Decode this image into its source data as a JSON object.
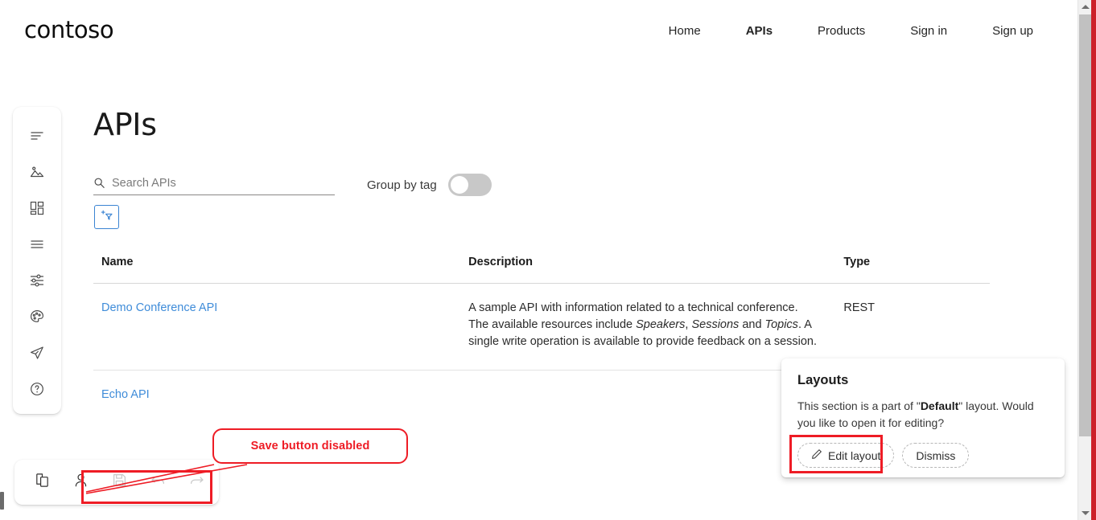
{
  "header": {
    "brand": "contoso",
    "nav": [
      {
        "label": "Home",
        "active": false
      },
      {
        "label": "APIs",
        "active": true
      },
      {
        "label": "Products",
        "active": false
      },
      {
        "label": "Sign in",
        "active": false
      },
      {
        "label": "Sign up",
        "active": false
      }
    ]
  },
  "editor_rail": {
    "items": [
      {
        "name": "content-icon",
        "label": "Content"
      },
      {
        "name": "media-icon",
        "label": "Media"
      },
      {
        "name": "widgets-icon",
        "label": "Widgets"
      },
      {
        "name": "pages-icon",
        "label": "Pages"
      },
      {
        "name": "settings-sliders-icon",
        "label": "Settings"
      },
      {
        "name": "theme-palette-icon",
        "label": "Styles"
      },
      {
        "name": "publish-icon",
        "label": "Publish"
      },
      {
        "name": "help-icon",
        "label": "Help"
      }
    ]
  },
  "main": {
    "title": "APIs",
    "search": {
      "placeholder": "Search APIs",
      "value": ""
    },
    "group_by_tag": {
      "label": "Group by tag",
      "state": "off"
    },
    "filter_button": {
      "name": "add-filter-button",
      "border_color": "#3b84d2"
    },
    "table": {
      "columns": [
        "Name",
        "Description",
        "Type"
      ],
      "rows": [
        {
          "name": "Demo Conference API",
          "description_lines": [
            {
              "segments": [
                {
                  "text": "A sample API with information related to a technical conference.",
                  "em": false
                }
              ]
            },
            {
              "segments": [
                {
                  "text": "The available resources include ",
                  "em": false
                },
                {
                  "text": "Speakers",
                  "em": true
                },
                {
                  "text": ", ",
                  "em": false
                },
                {
                  "text": "Sessions",
                  "em": true
                },
                {
                  "text": " and ",
                  "em": false
                },
                {
                  "text": "Topics",
                  "em": true
                },
                {
                  "text": ". A",
                  "em": false
                }
              ]
            },
            {
              "segments": [
                {
                  "text": "single write operation is available to provide feedback on a session.",
                  "em": false
                }
              ]
            }
          ],
          "type": "REST"
        },
        {
          "name": "Echo API",
          "description_lines": [],
          "type": ""
        }
      ]
    }
  },
  "layouts_popup": {
    "title": "Layouts",
    "body_prefix": "This section is a part of \"",
    "body_bold": "Default",
    "body_suffix": "\" layout. Would you like to open it for editing?",
    "edit_label": "Edit layout",
    "dismiss_label": "Dismiss"
  },
  "bottom_toolbar": {
    "buttons": [
      {
        "name": "duplicate-icon",
        "label": "Duplicate",
        "disabled": false
      },
      {
        "name": "user-icon",
        "label": "Profile",
        "disabled": false
      },
      {
        "name": "save-icon",
        "label": "Save",
        "disabled": true
      },
      {
        "name": "undo-icon",
        "label": "Undo",
        "disabled": true
      },
      {
        "name": "redo-icon",
        "label": "Redo",
        "disabled": true
      }
    ]
  },
  "annotations": {
    "callout_text": "Save button disabled",
    "color": "#ee1c25"
  },
  "colors": {
    "link": "#3f8cd9",
    "accent_blue": "#3b84d2",
    "annotation_red": "#ee1c25",
    "scrollbar_thumb": "#c1c1c1",
    "right_edge_red": "#cc2029"
  }
}
